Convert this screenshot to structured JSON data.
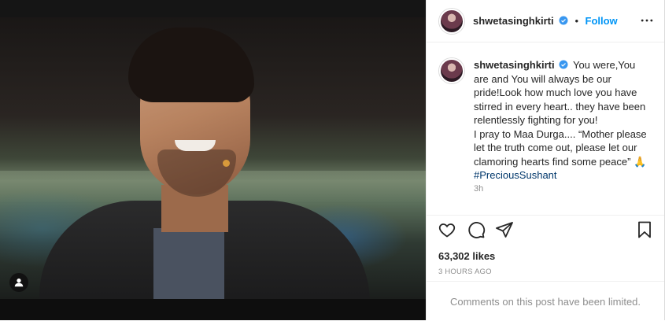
{
  "post": {
    "username": "shwetasinghkirti",
    "verified_icon": "verified-badge-icon",
    "separator": "•",
    "follow_label": "Follow",
    "caption_text": "You were,You are and You will always be our pride!Look how much love you have stirred in every heart.. they have been relentlessly fighting for you!",
    "caption_text_2": "I pray to Maa Durga.... “Mother please let the truth come out, please let our clamoring hearts find some peace”",
    "caption_emoji": "🙏",
    "hashtag": "#PreciousSushant",
    "time_ago": "3h",
    "likes": "63,302 likes",
    "date": "3 HOURS AGO",
    "comments_notice": "Comments on this post have been limited."
  },
  "icons": {
    "like": "heart-icon",
    "comment": "comment-icon",
    "share": "paper-plane-icon",
    "save": "bookmark-icon",
    "more": "more-options-icon",
    "tags": "user-tag-icon"
  },
  "colors": {
    "accent": "#0095f6",
    "hashtag": "#00376b",
    "muted": "#8e8e8e",
    "text": "#262626"
  }
}
